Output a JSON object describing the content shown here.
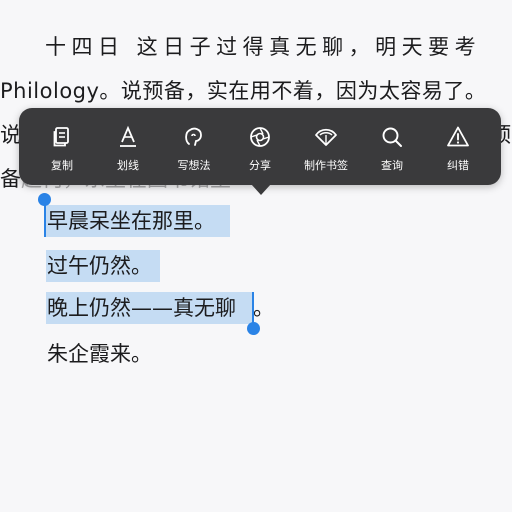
{
  "text": {
    "line1": "十四日 这日子过得真无聊，明天要考",
    "line2": "Philology。说预备，实在用不着，因为太容易了。",
    "line3": "说",
    "line3_right": "顶",
    "line4": "备",
    "line4_rest": "起何，东里在图书馆里",
    "selected1": "早晨呆坐在那里。",
    "selected2": "过午仍然。",
    "selected3": "晚上仍然——真无聊",
    "selected3_tail": "。",
    "line_last": "朱企霞来。"
  },
  "toolbar": {
    "items": [
      {
        "label": "复制",
        "icon": "copy-icon"
      },
      {
        "label": "划线",
        "icon": "underline-icon"
      },
      {
        "label": "写想法",
        "icon": "thought-icon"
      },
      {
        "label": "分享",
        "icon": "share-icon"
      },
      {
        "label": "制作书签",
        "icon": "bookmark-fan-icon"
      },
      {
        "label": "查询",
        "icon": "search-icon"
      },
      {
        "label": "纠错",
        "icon": "warning-icon"
      }
    ]
  },
  "colors": {
    "background": "#f7f7f9",
    "toolbar": "#3a3a3c",
    "selection": "#c5dcf3",
    "handle": "#2a83e6",
    "text": "#1c1c1e"
  }
}
